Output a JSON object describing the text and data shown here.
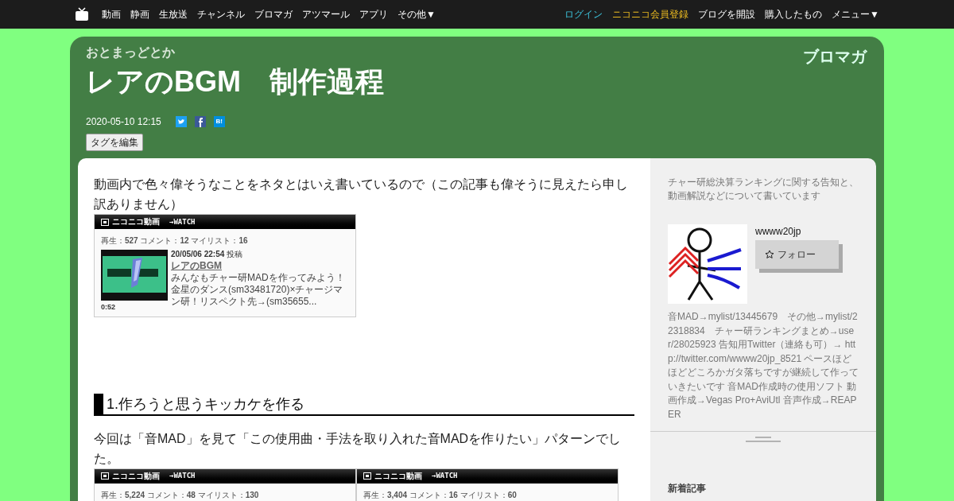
{
  "top_nav": {
    "left": [
      "動画",
      "静画",
      "生放送",
      "チャンネル",
      "ブロマガ",
      "アツマール",
      "アプリ",
      "その他▼"
    ],
    "right": [
      {
        "label": "ログイン",
        "kind": "login"
      },
      {
        "label": "ニコニコ会員登録",
        "kind": "register"
      },
      {
        "label": "ブログを開設",
        "kind": "plain"
      },
      {
        "label": "購入したもの",
        "kind": "plain"
      },
      {
        "label": "メニュー▼",
        "kind": "plain"
      }
    ]
  },
  "header": {
    "blog_name": "おとまっどとか",
    "brand": "ブロマガ",
    "title": "レアのBGM　制作過程",
    "date": "2020-05-10 12:15",
    "hatena": "B!",
    "edit_tags": "タグを編集"
  },
  "article": [
    {
      "kind": "paragraph",
      "text": "動画内で色々偉そうなことをネタとはいえ書いているので（この記事も偉そうに見えたら申し訳ありません）"
    },
    {
      "kind": "embeds",
      "items": [
        {
          "site": "ニコニコ動画",
          "watch": "→WATCH",
          "stats": "再生：**527** コメント：**12** マイリスト：**16**",
          "posted": "**20/05/06 22:54** 投稿",
          "title": "レアのBGM",
          "description": "みんなもチャー研MADを作ってみよう！金星のダンス(sm33481720)×チャージマン研！リスペクト先→(sm35655...",
          "duration": "0:52"
        }
      ]
    },
    {
      "kind": "heading",
      "text": "1.作ろうと思うキッカケを作る"
    },
    {
      "kind": "paragraph",
      "text": "今回は「音MAD」を見て「この使用曲・手法を取り入れた音MADを作りたい」パターンでした。"
    },
    {
      "kind": "embeds",
      "items": [
        {
          "site": "ニコニコ動画",
          "watch": "→WATCH",
          "stats": "再生：**5,224** コメント：**48** マイリスト：**130**"
        },
        {
          "site": "ニコニコ動画",
          "watch": "→WATCH",
          "stats": "再生：**3,404** コメント：**16** マイリスト：**60**"
        }
      ]
    }
  ],
  "sidebar": {
    "description": "チャー研総決算ランキングに関する告知と、動画解説などについて書いています",
    "user_name": "wwww20jp",
    "follow": "フォロー",
    "bio": "音MAD→mylist/13445679　その他→mylist/22318834　チャー研ランキングまとめ→user/28025923 告知用Twitter（連絡も可）→ http://twitter.com/wwww20jp_8521 ペースほどほどどころかガタ落ちですが継続して作っていきたいです 音MAD作成時の使用ソフト 動画作成→Vegas Pro+AviUtl 音声作成→REAPER",
    "new_posts": "新着記事"
  }
}
